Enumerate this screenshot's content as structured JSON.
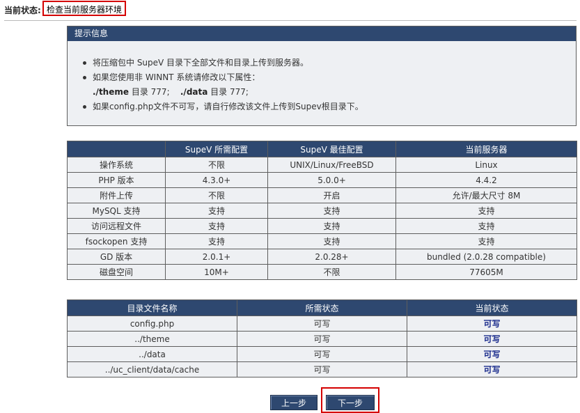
{
  "status": {
    "label": "当前状态:",
    "value": "检查当前服务器环境"
  },
  "tip": {
    "title": "提示信息",
    "items": [
      "将压缩包中 SupeV 目录下全部文件和目录上传到服务器。",
      "如果您使用非 WINNT 系统请修改以下属性：",
      "如果config.php文件不可写，请自行修改该文件上传到Supev根目录下。"
    ],
    "perm_theme_path": "./theme",
    "perm_theme_text": "目录 777;",
    "perm_data_path": "./data",
    "perm_data_text": "目录 777;"
  },
  "config_table": {
    "headers": [
      "",
      "SupeV 所需配置",
      "SupeV 最佳配置",
      "当前服务器"
    ],
    "rows": [
      [
        "操作系统",
        "不限",
        "UNIX/Linux/FreeBSD",
        "Linux"
      ],
      [
        "PHP 版本",
        "4.3.0+",
        "5.0.0+",
        "4.4.2"
      ],
      [
        "附件上传",
        "不限",
        "开启",
        "允许/最大尺寸 8M"
      ],
      [
        "MySQL 支持",
        "支持",
        "支持",
        "支持"
      ],
      [
        "访问远程文件",
        "支持",
        "支持",
        "支持"
      ],
      [
        "fsockopen 支持",
        "支持",
        "支持",
        "支持"
      ],
      [
        "GD 版本",
        "2.0.1+",
        "2.0.28+",
        "bundled (2.0.28 compatible)"
      ],
      [
        "磁盘空间",
        "10M+",
        "不限",
        "77605M"
      ]
    ]
  },
  "dir_table": {
    "headers": [
      "目录文件名称",
      "所需状态",
      "当前状态"
    ],
    "rows": [
      [
        "config.php",
        "可写",
        "可写"
      ],
      [
        "../theme",
        "可写",
        "可写"
      ],
      [
        "../data",
        "可写",
        "可写"
      ],
      [
        "../uc_client/data/cache",
        "可写",
        "可写"
      ]
    ]
  },
  "buttons": {
    "prev": "上一步",
    "next": "下一步"
  },
  "colors": {
    "header_bg": "#2e4870",
    "cell_bg": "#eef0f3",
    "highlight_border": "#d40000",
    "status_blue": "#1a2b8c"
  }
}
